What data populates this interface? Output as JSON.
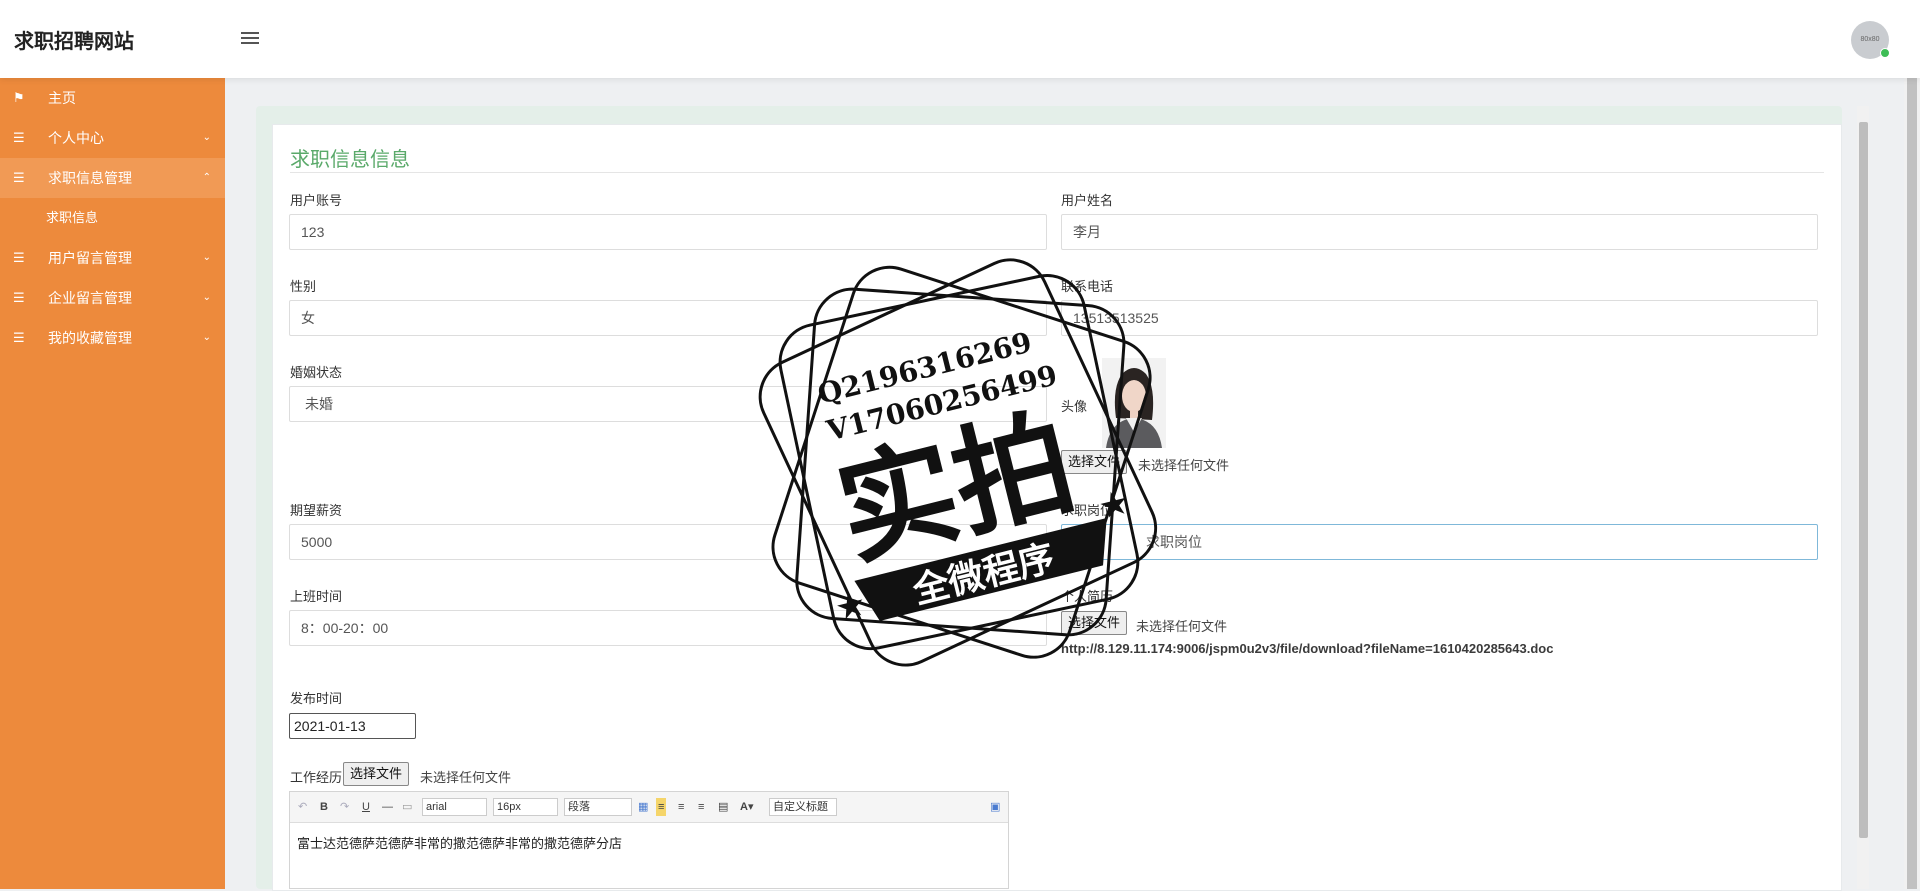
{
  "header": {
    "brand": "求职招聘网站",
    "avatar_text": "80x80"
  },
  "sidebar": {
    "items": [
      {
        "label": "主页",
        "icon": "flag-icon"
      },
      {
        "label": "个人中心",
        "icon": "list-icon"
      },
      {
        "label": "求职信息管理",
        "icon": "list-icon",
        "active": true
      },
      {
        "label": "用户留言管理",
        "icon": "list-icon"
      },
      {
        "label": "企业留言管理",
        "icon": "list-icon"
      },
      {
        "label": "我的收藏管理",
        "icon": "list-icon"
      }
    ],
    "sub_item": "求职信息"
  },
  "panel": {
    "title": "求职信息信息"
  },
  "form": {
    "account_label": "用户账号",
    "account_value": "123",
    "name_label": "用户姓名",
    "name_value": "李月",
    "gender_label": "性别",
    "gender_value": "女",
    "phone_label": "联系电话",
    "phone_value": "13513513525",
    "marital_label": "婚姻状态",
    "marital_value": "未婚",
    "photo_label": "头像",
    "salary_label": "期望薪资",
    "salary_value": "5000",
    "position_label": "求职岗位",
    "position_value": "求职岗位",
    "hours_label": "上班时间",
    "hours_value": "8：00-20：00",
    "resume_label": "个人简历",
    "resume_link": "http://8.129.11.174:9006/jspm0u2v3/file/download?fileName=1610420285643.doc",
    "publish_label": "发布时间",
    "publish_value": "2021-01-13",
    "experience_label": "工作经历",
    "file_button": "选择文件",
    "file_none": "未选择任何文件"
  },
  "editor": {
    "font": "arial",
    "size": "16px",
    "paragraph": "段落",
    "custom_title": "自定义标题",
    "content": "富士达范德萨范德萨非常的撒范德萨非常的撒范德萨分店"
  },
  "stamp": {
    "line1": "Q2196316269",
    "line2": "V17060256499",
    "big": "实拍",
    "banner": "全微程序"
  },
  "colors": {
    "sidebar": "#ed8a3c",
    "title_green": "#5aa96a"
  }
}
